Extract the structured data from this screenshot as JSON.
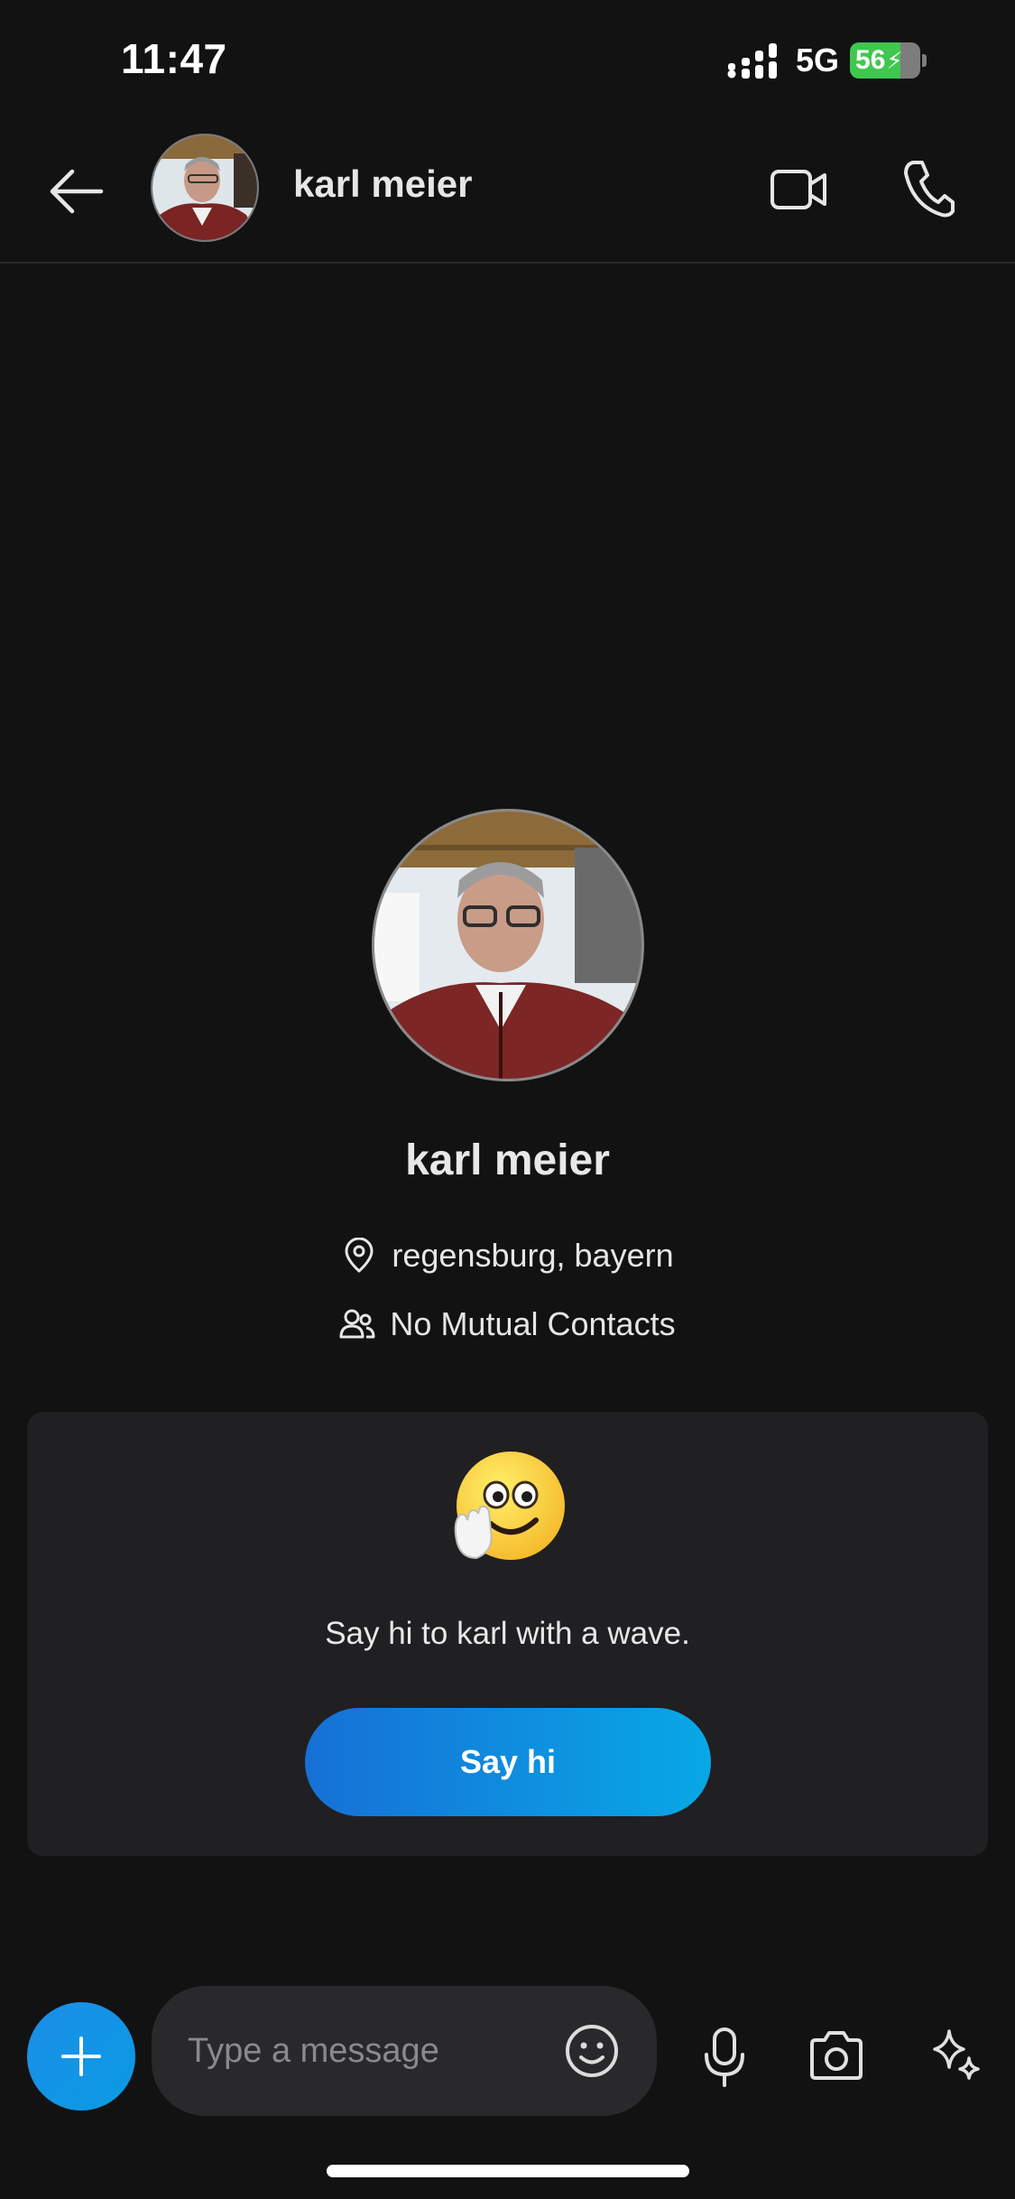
{
  "status_bar": {
    "time": "11:47",
    "network": "5G",
    "battery_level": "56",
    "battery_color": "#3fc74e"
  },
  "header": {
    "back_icon": "arrow-left-icon",
    "contact_name": "karl meier",
    "video_icon": "video-camera-icon",
    "call_icon": "phone-icon"
  },
  "profile": {
    "name": "karl meier",
    "location": "regensburg, bayern",
    "location_icon": "location-pin-icon",
    "mutual_contacts": "No Mutual Contacts",
    "mutual_icon": "people-icon"
  },
  "wave_card": {
    "emoji": "waving-smiley-icon",
    "prompt": "Say hi to karl with a wave.",
    "button_label": "Say hi",
    "button_gradient": [
      "#1670d6",
      "#08a8e6"
    ]
  },
  "composer": {
    "plus_icon": "plus-icon",
    "placeholder": "Type a message",
    "value": "",
    "emoji_icon": "smiley-icon",
    "mic_icon": "microphone-icon",
    "camera_icon": "camera-icon",
    "sparkle_icon": "sparkle-icon"
  },
  "theme": {
    "background": "#121213",
    "card_background": "#201f22",
    "accent": "#0a9be3"
  }
}
